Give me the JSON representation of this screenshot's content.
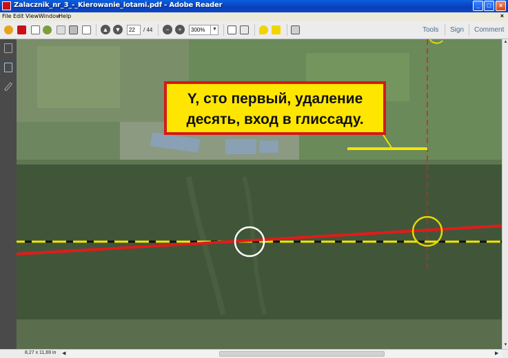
{
  "window": {
    "title": "Zalacznik_nr_3_-_Kierowanie_lotami.pdf - Adobe Reader",
    "controls": [
      "_",
      "□",
      "×"
    ]
  },
  "menu": {
    "items": [
      "File",
      "Edit",
      "View",
      "Window",
      "Help"
    ],
    "close": "×"
  },
  "toolbar": {
    "page_current": "22",
    "page_total": "/ 44",
    "zoom": "300%",
    "right_links": [
      "Tools",
      "Sign",
      "Comment"
    ]
  },
  "document": {
    "callout_line1": "Y,  сто первый,  удаление",
    "callout_line2": "десять, вход в глиссаду."
  },
  "status": {
    "page_size": "8,27 x 11,69 in"
  },
  "colors": {
    "callout_fill": "#ffe600",
    "callout_border": "#d41a1a",
    "course_line": "#e11b1b",
    "centerline_yellow": "#f2e600",
    "circle_white": "#ffffff",
    "circle_yellow": "#e8d800"
  }
}
